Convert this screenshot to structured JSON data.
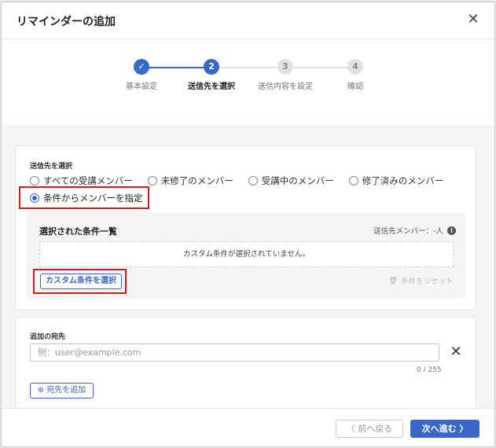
{
  "dialog": {
    "title": "リマインダーの追加",
    "close_icon": "✕"
  },
  "stepper": {
    "steps": [
      {
        "number": "✓",
        "label": "基本設定",
        "state": "done"
      },
      {
        "number": "2",
        "label": "送信先を選択",
        "state": "active"
      },
      {
        "number": "3",
        "label": "送信内容を設定",
        "state": "todo"
      },
      {
        "number": "4",
        "label": "確認",
        "state": "todo"
      }
    ]
  },
  "recipients": {
    "section_label": "送信先を選択",
    "options": [
      "すべての受講メンバー",
      "未修了のメンバー",
      "受講中のメンバー",
      "修了済みのメンバー",
      "条件からメンバーを指定"
    ],
    "selected_index": 4,
    "conditions_title": "選択された条件一覧",
    "sender_count": "送信先メンバー：-人",
    "info_icon": "i",
    "empty_message": "カスタム条件が選択されていません。",
    "select_custom_button": "カスタム条件を選択",
    "reset_icon": "🗑",
    "reset_label": "条件をリセット"
  },
  "additional": {
    "section_label": "追加の宛先",
    "placeholder": "例：user@example.com",
    "value": "",
    "clear_icon": "✕",
    "counter": "0 / 255",
    "add_icon": "⊕",
    "add_button": "宛先を追加"
  },
  "footer": {
    "prev_label": "〈 前へ戻る",
    "next_label": "次へ進む 〉"
  },
  "colors": {
    "primary": "#3a68c9",
    "highlight": "#d41b1b"
  }
}
